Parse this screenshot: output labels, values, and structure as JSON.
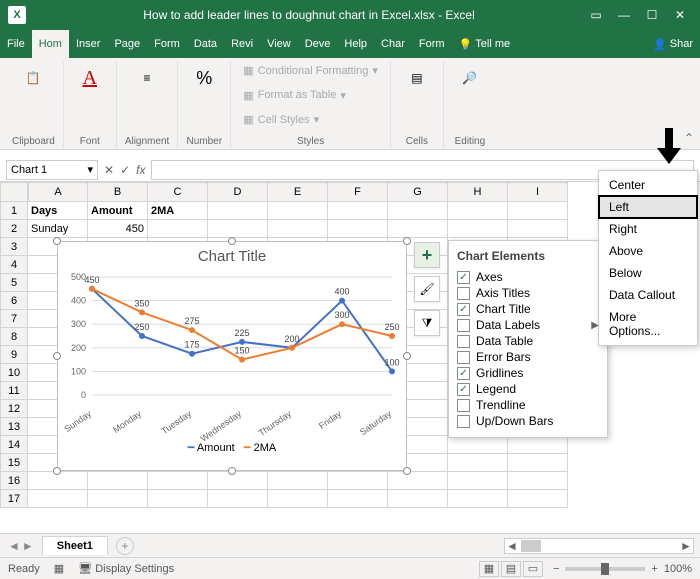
{
  "titlebar": {
    "excel_letter": "X",
    "title": "How to add leader lines to doughnut chart in Excel.xlsx - Excel"
  },
  "tabs": {
    "file": "File",
    "home": "Hom",
    "insert": "Inser",
    "page": "Page",
    "form": "Form",
    "data": "Data",
    "review": "Revi",
    "view": "View",
    "dev": "Deve",
    "help": "Help",
    "chart": "Char",
    "format": "Form",
    "tellme": "Tell me",
    "share": "Shar"
  },
  "ribbon": {
    "clipboard": "Clipboard",
    "font": "Font",
    "alignment": "Alignment",
    "number": "Number",
    "cond_fmt": "Conditional Formatting",
    "fmt_table": "Format as Table",
    "cell_styles": "Cell Styles",
    "styles": "Styles",
    "cells": "Cells",
    "editing": "Editing",
    "font_letter": "A",
    "number_symbol": "%"
  },
  "namebox": {
    "value": "Chart 1"
  },
  "columns": [
    "A",
    "B",
    "C",
    "D",
    "E",
    "F",
    "G",
    "H",
    "I"
  ],
  "rows": [
    "1",
    "2",
    "3",
    "4",
    "5",
    "6",
    "7",
    "8",
    "9",
    "10",
    "11",
    "12",
    "13",
    "14",
    "15",
    "16",
    "17"
  ],
  "headers": {
    "a1": "Days",
    "b1": "Amount",
    "c1": "2MA"
  },
  "row2": {
    "a": "Sunday",
    "b": "450",
    "c": ""
  },
  "chart": {
    "title": "Chart Title",
    "legend_amount": "Amount",
    "legend_2ma": "2MA"
  },
  "chart_data": {
    "type": "line",
    "categories": [
      "Sunday",
      "Monday",
      "Tuesday",
      "Wednesday",
      "Thursday",
      "Friday",
      "Saturday"
    ],
    "series": [
      {
        "name": "Amount",
        "color": "#4472C4",
        "values": [
          450,
          250,
          175,
          225,
          200,
          400,
          100
        ],
        "labels": [
          450,
          250,
          175,
          225,
          200,
          400,
          100
        ]
      },
      {
        "name": "2MA",
        "color": "#ED7D31",
        "values": [
          450,
          350,
          275,
          150,
          200,
          300,
          250
        ],
        "labels": [
          null,
          350,
          275,
          150,
          null,
          300,
          250
        ]
      }
    ],
    "ylim": [
      0,
      500
    ],
    "yticks": [
      0,
      100,
      200,
      300,
      400,
      500
    ],
    "title": "Chart Title"
  },
  "chart_elements": {
    "title": "Chart Elements",
    "items": [
      {
        "label": "Axes",
        "checked": true,
        "arrow": false
      },
      {
        "label": "Axis Titles",
        "checked": false,
        "arrow": false
      },
      {
        "label": "Chart Title",
        "checked": true,
        "arrow": false
      },
      {
        "label": "Data Labels",
        "checked": false,
        "arrow": true
      },
      {
        "label": "Data Table",
        "checked": false,
        "arrow": false
      },
      {
        "label": "Error Bars",
        "checked": false,
        "arrow": false
      },
      {
        "label": "Gridlines",
        "checked": true,
        "arrow": false
      },
      {
        "label": "Legend",
        "checked": true,
        "arrow": false
      },
      {
        "label": "Trendline",
        "checked": false,
        "arrow": false
      },
      {
        "label": "Up/Down Bars",
        "checked": false,
        "arrow": false
      }
    ]
  },
  "submenu": {
    "items": [
      "Center",
      "Left",
      "Right",
      "Above",
      "Below",
      "Data Callout",
      "More Options..."
    ],
    "selected": "Left"
  },
  "sheets": {
    "sheet1": "Sheet1"
  },
  "status": {
    "ready": "Ready",
    "display": "Display Settings",
    "zoom": "100%"
  }
}
